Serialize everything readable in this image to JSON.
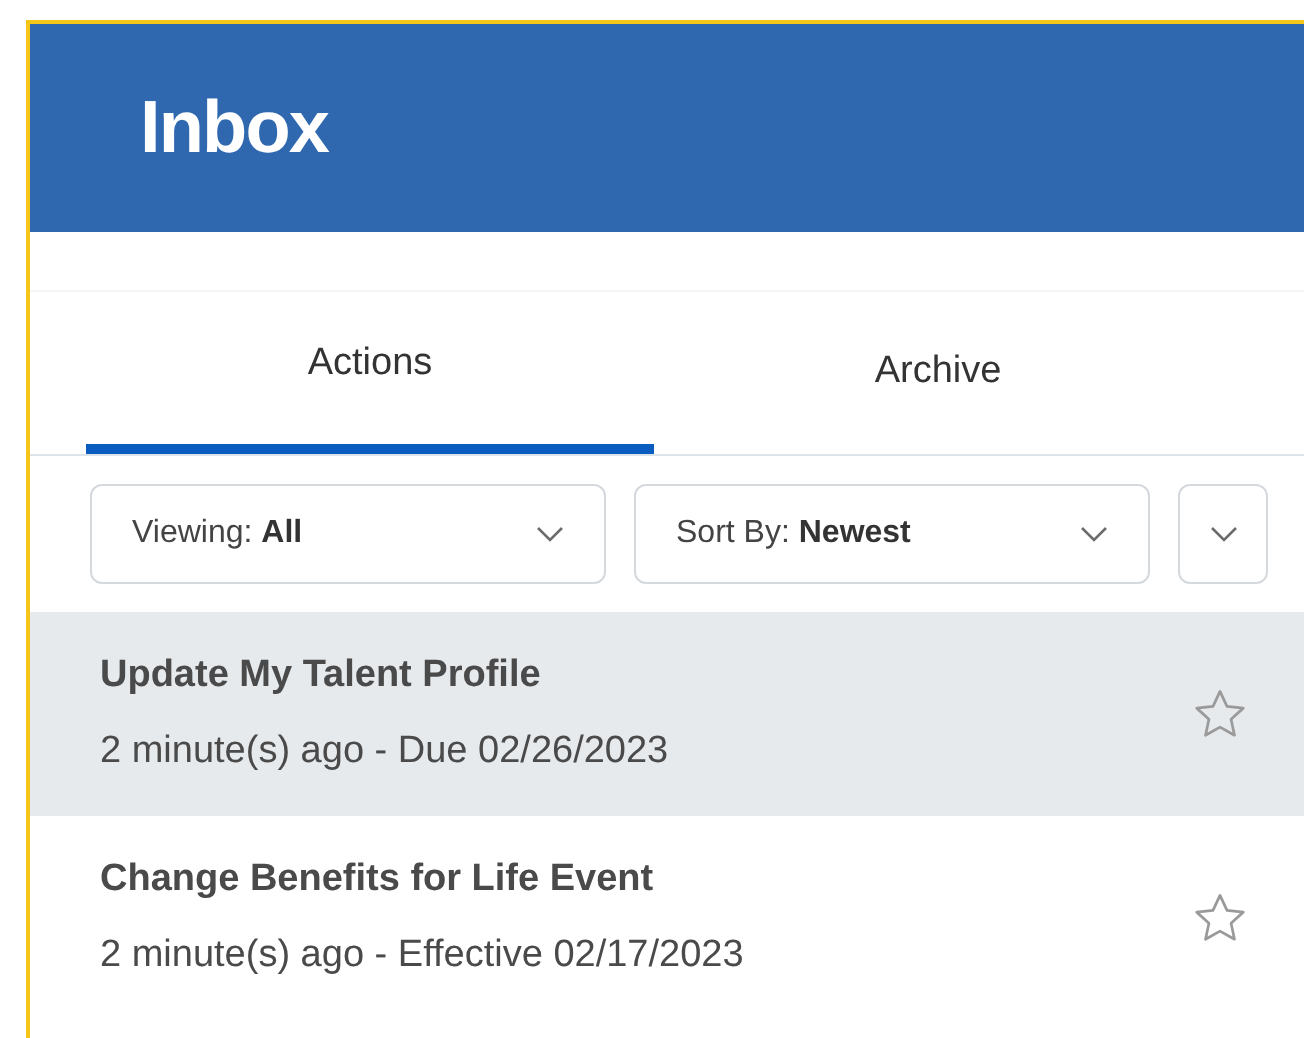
{
  "header": {
    "title": "Inbox"
  },
  "tabs": [
    {
      "label": "Actions",
      "selected": true
    },
    {
      "label": "Archive",
      "selected": false
    }
  ],
  "filters": [
    {
      "label": "Viewing:",
      "value": "All"
    },
    {
      "label": "Sort By:",
      "value": "Newest"
    }
  ],
  "items": [
    {
      "title": "Update My Talent Profile",
      "subtitle": "2 minute(s) ago - Due 02/26/2023",
      "selected": true,
      "starred": false
    },
    {
      "title": "Change Benefits for Life Event",
      "subtitle": "2 minute(s) ago - Effective 02/17/2023",
      "selected": false,
      "starred": false
    }
  ]
}
